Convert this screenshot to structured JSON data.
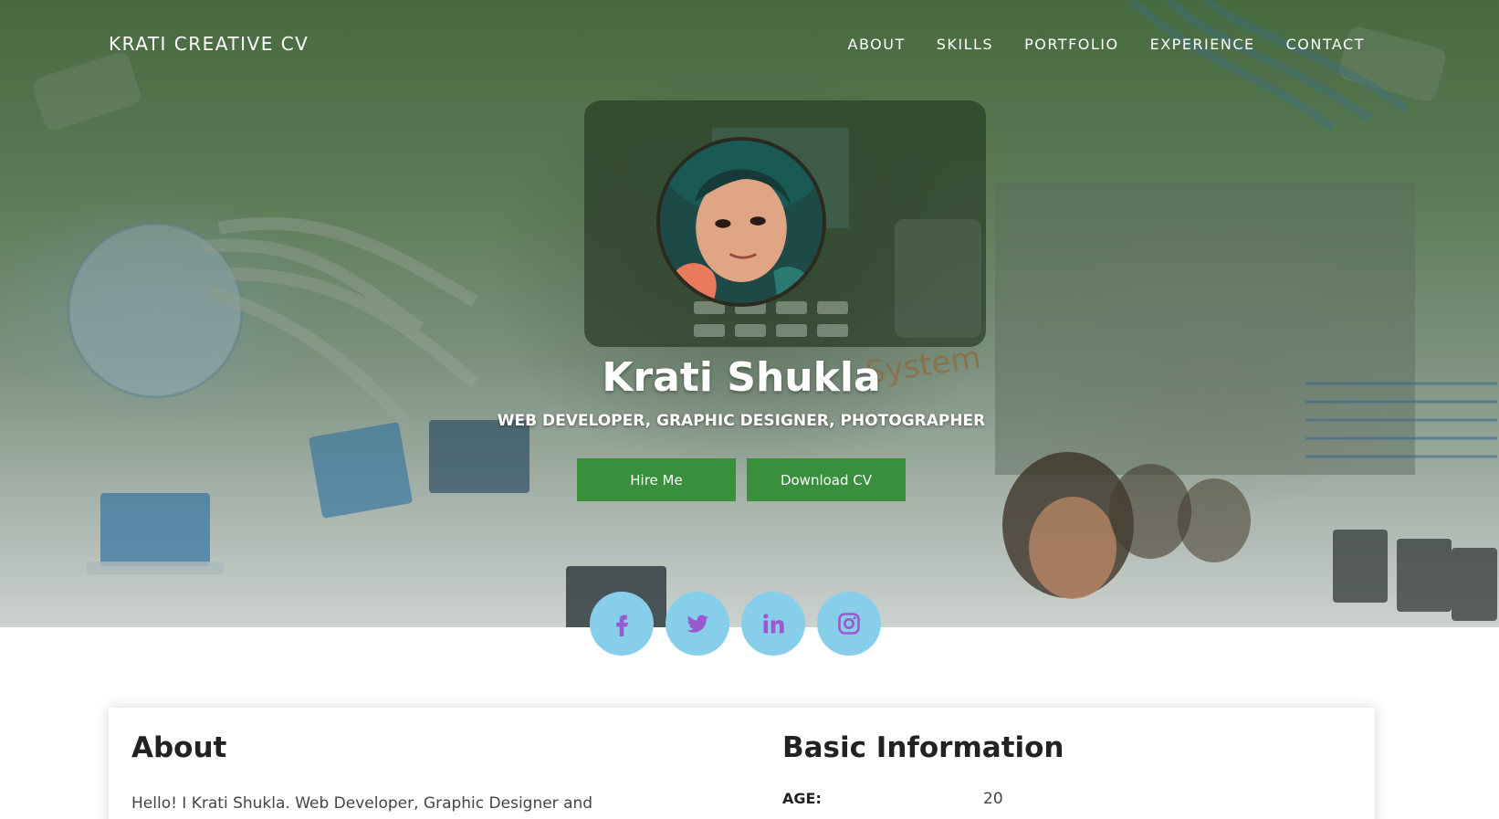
{
  "header": {
    "brand": "KRATI CREATIVE CV",
    "nav": [
      "ABOUT",
      "SKILLS",
      "PORTFOLIO",
      "EXPERIENCE",
      "CONTACT"
    ]
  },
  "hero": {
    "name": "Krati Shukla",
    "tagline": "WEB DEVELOPER, GRAPHIC DESIGNER, PHOTOGRAPHER",
    "hire_label": "Hire Me",
    "download_label": "Download CV",
    "socials": [
      "facebook-icon",
      "twitter-icon",
      "linkedin-icon",
      "instagram-icon"
    ]
  },
  "about": {
    "title": "About",
    "text": "Hello! I Krati Shukla. Web Developer, Graphic Designer and Photographer."
  },
  "basic_info": {
    "title": "Basic Information",
    "items": [
      {
        "label": "AGE:",
        "value": "20"
      }
    ]
  },
  "colors": {
    "accent_green": "#3a8f3d",
    "social_bg": "#87ceeb",
    "social_icon": "#9b59d0",
    "overlay_green": "#26501e"
  }
}
